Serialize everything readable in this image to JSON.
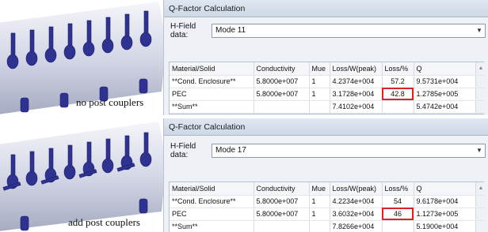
{
  "panels": [
    {
      "caption": "no post couplers",
      "dialog": {
        "title": "Q-Factor Calculation",
        "hfield_label": "H-Field data:",
        "hfield_value": "Mode 11",
        "headers": [
          "Material/Solid",
          "Conductivity",
          "Mue",
          "Loss/W(peak)",
          "Loss/%",
          "Q"
        ],
        "rows": [
          [
            "**Cond. Enclosure**",
            "5.8000e+007",
            "1",
            "4.2374e+004",
            "57.2",
            "9.5731e+004"
          ],
          [
            "PEC",
            "5.8000e+007",
            "1",
            "3.1728e+004",
            "42.8",
            "1.2785e+005"
          ],
          [
            "**Sum**",
            "",
            "",
            "7.4102e+004",
            "",
            "5.4742e+004"
          ]
        ],
        "highlight": {
          "row": 1,
          "col": 4
        }
      }
    },
    {
      "caption": "add post couplers",
      "dialog": {
        "title": "Q-Factor Calculation",
        "hfield_label": "H-Field data:",
        "hfield_value": "Mode 17",
        "headers": [
          "Material/Solid",
          "Conductivity",
          "Mue",
          "Loss/W(peak)",
          "Loss/%",
          "Q"
        ],
        "rows": [
          [
            "**Cond. Enclosure**",
            "5.8000e+007",
            "1",
            "4.2234e+004",
            "54",
            "9.6178e+004"
          ],
          [
            "PEC",
            "5.8000e+007",
            "1",
            "3.6032e+004",
            "46",
            "1.1273e+005"
          ],
          [
            "**Sum**",
            "",
            "",
            "7.8266e+004",
            "",
            "5.1900e+004"
          ]
        ],
        "highlight": {
          "row": 1,
          "col": 4
        }
      }
    }
  ],
  "icons": {
    "combo_arrow": "chevron-down-icon",
    "scroll_up": "scroll-up-icon"
  },
  "colors": {
    "highlight_box": "#d22222",
    "tank": "#aab0c8",
    "drift_tubes": "#2a2f8c"
  }
}
